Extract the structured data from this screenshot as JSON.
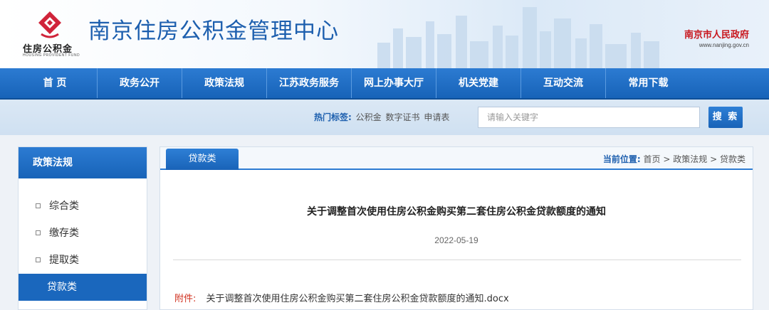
{
  "header": {
    "logo_text": "住房公积金",
    "logo_en": "HOUSING PROVIDENT FUND",
    "site_title": "南京住房公积金管理中心",
    "gov_name": "南京市人民政府",
    "gov_url": "www.nanjing.gov.cn"
  },
  "nav": {
    "items": [
      {
        "label": "首 页"
      },
      {
        "label": "政务公开"
      },
      {
        "label": "政策法规"
      },
      {
        "label": "江苏政务服务"
      },
      {
        "label": "网上办事大厅"
      },
      {
        "label": "机关党建"
      },
      {
        "label": "互动交流"
      },
      {
        "label": "常用下载"
      }
    ]
  },
  "search": {
    "hot_label": "热门标签:",
    "hot_tags": [
      "公积金",
      "数字证书",
      "申请表"
    ],
    "placeholder": "请输入关键字",
    "button_label": "搜 索"
  },
  "sidebar": {
    "title": "政策法规",
    "items": [
      {
        "label": "综合类"
      },
      {
        "label": "缴存类"
      },
      {
        "label": "提取类"
      },
      {
        "label": "贷款类"
      }
    ],
    "active_index": 3
  },
  "main": {
    "tab_label": "贷款类",
    "breadcrumb": {
      "label": "当前位置:",
      "items": [
        "首页",
        "政策法规",
        "贷款类"
      ],
      "separator": ">"
    },
    "article": {
      "title": "关于调整首次使用住房公积金购买第二套住房公积金贷款额度的通知",
      "date": "2022-05-19",
      "attachment_label": "附件:",
      "attachment_name": "关于调整首次使用住房公积金购买第二套住房公积金贷款额度的通知.docx"
    }
  },
  "colors": {
    "brand_blue": "#1d5fae",
    "nav_blue": "#1763b8",
    "gov_red": "#c8161d",
    "logo_red": "#d0243a",
    "attach_red": "#d0301f"
  }
}
